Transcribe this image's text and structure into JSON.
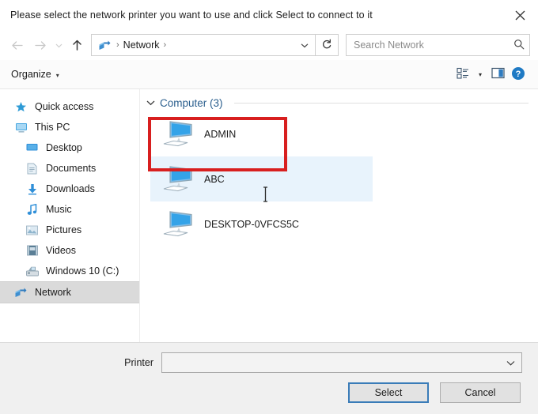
{
  "window": {
    "title": "Please select the network printer you want to use and click Select to connect to it",
    "close_icon": "close-icon"
  },
  "nav": {
    "back_icon": "arrow-left-icon",
    "forward_icon": "arrow-right-icon",
    "recent_icon": "chevron-down-icon",
    "up_icon": "arrow-up-icon",
    "address": {
      "icon": "network-icon",
      "leading_separator": "›",
      "crumb": "Network",
      "trailing_separator": "›",
      "dropdown_icon": "chevron-down-icon"
    },
    "refresh_icon": "refresh-icon",
    "search": {
      "placeholder": "Search Network",
      "value": "",
      "icon": "search-icon"
    }
  },
  "toolbar": {
    "organize_label": "Organize",
    "organize_caret": "▾",
    "view_icon": "view-options-icon",
    "view_caret": "▾",
    "preview_pane_icon": "preview-pane-icon",
    "help_icon": "help-icon",
    "help_glyph": "?"
  },
  "sidebar": {
    "items": [
      {
        "label": "Quick access",
        "icon": "star-icon",
        "indent": false,
        "selected": false
      },
      {
        "label": "This PC",
        "icon": "monitor-icon",
        "indent": false,
        "selected": false
      },
      {
        "label": "Desktop",
        "icon": "desktop-icon",
        "indent": true,
        "selected": false
      },
      {
        "label": "Documents",
        "icon": "documents-icon",
        "indent": true,
        "selected": false
      },
      {
        "label": "Downloads",
        "icon": "downloads-icon",
        "indent": true,
        "selected": false
      },
      {
        "label": "Music",
        "icon": "music-icon",
        "indent": true,
        "selected": false
      },
      {
        "label": "Pictures",
        "icon": "pictures-icon",
        "indent": true,
        "selected": false
      },
      {
        "label": "Videos",
        "icon": "videos-icon",
        "indent": true,
        "selected": false
      },
      {
        "label": "Windows 10 (C:)",
        "icon": "drive-icon",
        "indent": true,
        "selected": false
      },
      {
        "label": "Network",
        "icon": "network-icon",
        "indent": false,
        "selected": true
      }
    ]
  },
  "content": {
    "group": {
      "chevron": "⌄",
      "title": "Computer (3)"
    },
    "items": [
      {
        "label": "ADMIN",
        "icon": "computer-icon",
        "hovered": false,
        "annotated": true
      },
      {
        "label": "ABC",
        "icon": "computer-icon",
        "hovered": true,
        "annotated": false
      },
      {
        "label": "DESKTOP-0VFCS5C",
        "icon": "computer-icon",
        "hovered": false,
        "annotated": false
      }
    ],
    "annotation_color": "#d81f1f",
    "hover_color": "#e8f3fc",
    "cursor": "text-ibeam-cursor"
  },
  "footer": {
    "printer_label": "Printer",
    "printer_value": "",
    "printer_caret": "⌄",
    "select_label": "Select",
    "cancel_label": "Cancel"
  }
}
